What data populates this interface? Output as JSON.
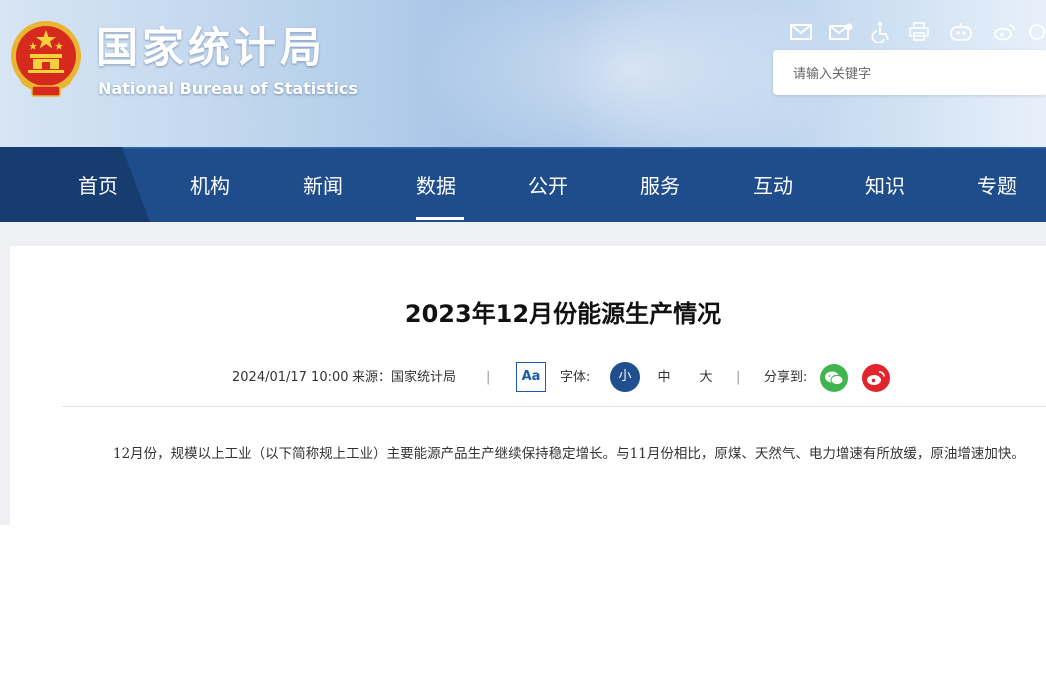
{
  "header": {
    "site_title_zh": "国家统计局",
    "site_title_en": "National Bureau of Statistics",
    "tools": [
      {
        "icon": "mail-icon"
      },
      {
        "icon": "message-icon"
      },
      {
        "icon": "accessibility-icon"
      },
      {
        "icon": "print-icon"
      },
      {
        "icon": "robot-icon"
      },
      {
        "icon": "weibo-icon"
      }
    ],
    "search": {
      "placeholder": "请输入关键字"
    }
  },
  "nav": {
    "items": [
      {
        "label": "首页"
      },
      {
        "label": "机构"
      },
      {
        "label": "新闻"
      },
      {
        "label": "数据",
        "active": true
      },
      {
        "label": "公开"
      },
      {
        "label": "服务"
      },
      {
        "label": "互动"
      },
      {
        "label": "知识"
      },
      {
        "label": "专题"
      }
    ]
  },
  "article": {
    "title": "2023年12月份能源生产情况",
    "date": "2024/01/17 10:00",
    "source": "来源：国家统计局",
    "separator": "|",
    "aa_label": "Aa",
    "font_label": "字体:",
    "font_sizes": [
      "小",
      "中",
      "大"
    ],
    "share_label": "分享到:",
    "body": "12月份，规模以上工业（以下简称规上工业）主要能源产品生产继续保持稳定增长。与11月份相比，原煤、天然气、电力增速有所放缓，原油增速加快。"
  },
  "colors": {
    "nav_bg": "#1f4d8c",
    "nav_home_bg": "#173c70",
    "accent_blue": "#1e5ca8",
    "wechat_green": "#3fb54f",
    "weibo_red": "#e2242d"
  }
}
